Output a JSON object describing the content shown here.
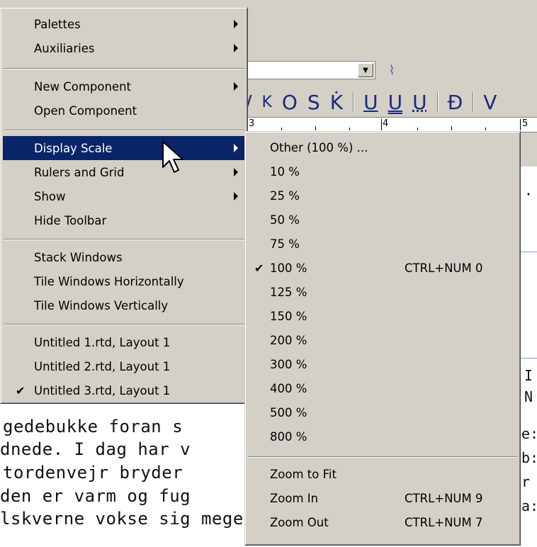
{
  "main_menu": {
    "items": [
      {
        "label": "Palettes",
        "submenu": true
      },
      {
        "label": "Auxiliaries",
        "submenu": true
      },
      {
        "label": "New Component",
        "submenu": true
      },
      {
        "label": "Open Component",
        "submenu": false
      },
      {
        "label": "Display Scale",
        "submenu": true,
        "highlighted": true
      },
      {
        "label": "Rulers and Grid",
        "submenu": true
      },
      {
        "label": "Show",
        "submenu": true
      },
      {
        "label": "Hide Toolbar",
        "submenu": false
      },
      {
        "label": "Stack Windows",
        "submenu": false
      },
      {
        "label": "Tile Windows Horizontally",
        "submenu": false
      },
      {
        "label": "Tile Windows Vertically",
        "submenu": false
      },
      {
        "label": "Untitled 1.rtd, Layout 1",
        "submenu": false
      },
      {
        "label": "Untitled 2.rtd, Layout 1",
        "submenu": false
      },
      {
        "label": "Untitled 3.rtd, Layout 1",
        "submenu": false,
        "checked": true
      }
    ]
  },
  "display_scale_menu": {
    "items": [
      {
        "label": "Other (100 %) ...",
        "shortcut": ""
      },
      {
        "label": "10 %",
        "shortcut": ""
      },
      {
        "label": "25 %",
        "shortcut": ""
      },
      {
        "label": "50 %",
        "shortcut": ""
      },
      {
        "label": "75 %",
        "shortcut": ""
      },
      {
        "label": "100 %",
        "shortcut": "CTRL+NUM 0",
        "checked": true
      },
      {
        "label": "125 %",
        "shortcut": ""
      },
      {
        "label": "150 %",
        "shortcut": ""
      },
      {
        "label": "200 %",
        "shortcut": ""
      },
      {
        "label": "300 %",
        "shortcut": ""
      },
      {
        "label": "400 %",
        "shortcut": ""
      },
      {
        "label": "500 %",
        "shortcut": ""
      },
      {
        "label": "800 %",
        "shortcut": ""
      },
      {
        "label": "Zoom to Fit",
        "shortcut": ""
      },
      {
        "label": "Zoom In",
        "shortcut": "CTRL+NUM 9"
      },
      {
        "label": "Zoom Out",
        "shortcut": "CTRL+NUM 7"
      }
    ]
  },
  "check_glyph": "✔",
  "toolbar": {
    "format_glyphs": [
      "/",
      "K",
      "O",
      "S",
      "K̇",
      "U",
      "U",
      "U",
      "Ð",
      "V"
    ]
  },
  "ruler": {
    "labels": [
      "3",
      "4",
      "5"
    ]
  },
  "document": {
    "lines": [
      "gedebukke foran s",
      "dnede. I dag har v",
      "tordenvejr bryder",
      "den er varm og fug",
      "lskverne vokse sig meget høje."
    ],
    "right_edge_chars": [
      "·",
      "I",
      "N",
      "e:",
      "b:",
      "r",
      "a:"
    ]
  },
  "colors": {
    "menu_bg": "#d4d0c8",
    "highlight": "#0a246a",
    "highlight_text": "#ffffff"
  }
}
